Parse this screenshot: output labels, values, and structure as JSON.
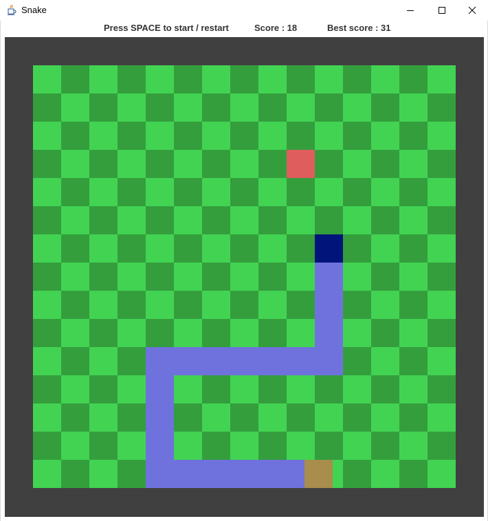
{
  "window": {
    "title": "Snake",
    "controls": [
      "minimize-icon",
      "maximize-icon",
      "close-icon"
    ]
  },
  "hud": {
    "start_hint": "Press SPACE to start / restart",
    "score_text": "Score : 18",
    "best_text": "Best score : 31"
  },
  "colors": {
    "light_tile": "#42d352",
    "dark_tile": "#349e3d",
    "frame": "#404040",
    "snake_body": "#6f72dd",
    "snake_head": "#001479",
    "food": "#e05d5d",
    "tail_tile": "#a88d4c"
  },
  "grid": {
    "cols": 15,
    "rows": 15
  },
  "food": {
    "col": 9,
    "row": 3
  },
  "snake": {
    "head": {
      "col": 10,
      "row": 6
    },
    "body": [
      {
        "col": 10,
        "row": 7
      },
      {
        "col": 10,
        "row": 8
      },
      {
        "col": 10,
        "row": 9
      },
      {
        "col": 10,
        "row": 10
      },
      {
        "col": 9,
        "row": 10
      },
      {
        "col": 8,
        "row": 10
      },
      {
        "col": 7,
        "row": 10
      },
      {
        "col": 6,
        "row": 10
      },
      {
        "col": 5,
        "row": 10
      },
      {
        "col": 4,
        "row": 10
      },
      {
        "col": 4,
        "row": 11
      },
      {
        "col": 4,
        "row": 12
      },
      {
        "col": 4,
        "row": 13
      },
      {
        "col": 4,
        "row": 14
      },
      {
        "col": 5,
        "row": 14
      },
      {
        "col": 6,
        "row": 14
      },
      {
        "col": 7,
        "row": 14
      },
      {
        "col": 8,
        "row": 14
      },
      {
        "col": 9,
        "row": 14
      }
    ],
    "tail_marker": {
      "col": 10,
      "row": 14
    }
  }
}
